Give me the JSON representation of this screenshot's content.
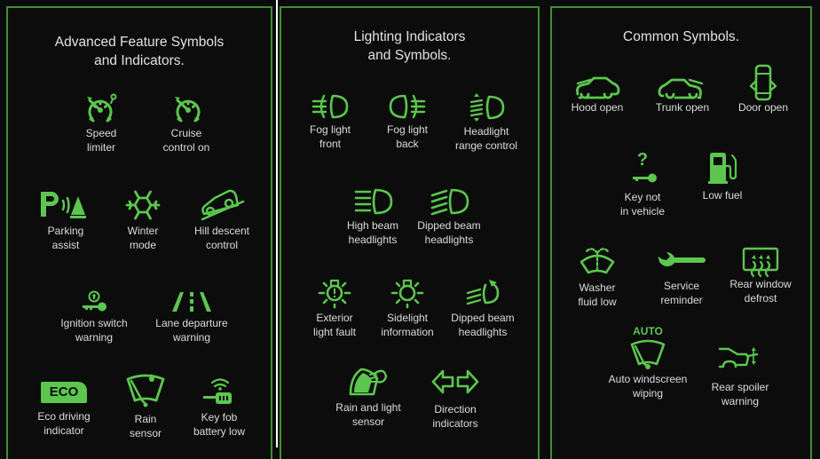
{
  "accent_color": "#5cc64f",
  "border_color": "#3f8f33",
  "panels": [
    {
      "title_line1": "Advanced Feature Symbols",
      "title_line2": "and Indicators.",
      "items": [
        {
          "icon": "speed-limiter-icon",
          "line1": "Speed",
          "line2": "limiter"
        },
        {
          "icon": "cruise-control-icon",
          "line1": "Cruise",
          "line2": "control on"
        },
        {
          "icon": "parking-assist-icon",
          "line1": "Parking",
          "line2": "assist"
        },
        {
          "icon": "winter-mode-icon",
          "line1": "Winter",
          "line2": "mode"
        },
        {
          "icon": "hill-descent-icon",
          "line1": "Hill descent",
          "line2": "control"
        },
        {
          "icon": "ignition-switch-icon",
          "line1": "Ignition switch",
          "line2": "warning"
        },
        {
          "icon": "lane-departure-icon",
          "line1": "Lane departure",
          "line2": "warning"
        },
        {
          "icon": "eco-driving-icon",
          "icon_text": "ECO",
          "line1": "Eco driving",
          "line2": "indicator"
        },
        {
          "icon": "rain-sensor-icon",
          "line1": "Rain",
          "line2": "sensor"
        },
        {
          "icon": "key-fob-battery-icon",
          "line1": "Key fob",
          "line2": "battery low"
        }
      ]
    },
    {
      "title_line1": "Lighting Indicators",
      "title_line2": "and Symbols.",
      "items": [
        {
          "icon": "fog-light-front-icon",
          "line1": "Fog light",
          "line2": "front"
        },
        {
          "icon": "fog-light-back-icon",
          "line1": "Fog light",
          "line2": "back"
        },
        {
          "icon": "headlight-range-icon",
          "line1": "Headlight",
          "line2": "range control"
        },
        {
          "icon": "high-beam-icon",
          "line1": "High beam",
          "line2": "headlights"
        },
        {
          "icon": "dipped-beam-icon",
          "line1": "Dipped beam",
          "line2": "headlights"
        },
        {
          "icon": "exterior-light-fault-icon",
          "line1": "Exterior",
          "line2": "light fault"
        },
        {
          "icon": "sidelight-icon",
          "line1": "Sidelight",
          "line2": "information"
        },
        {
          "icon": "dipped-beam-adaptive-icon",
          "line1": "Dipped beam",
          "line2": "headlights"
        },
        {
          "icon": "rain-light-sensor-icon",
          "line1": "Rain and light",
          "line2": "sensor"
        },
        {
          "icon": "direction-indicators-icon",
          "line1": "Direction",
          "line2": "indicators"
        }
      ]
    },
    {
      "title_line1": "Common Symbols.",
      "items": [
        {
          "icon": "hood-open-icon",
          "line1": "Hood open"
        },
        {
          "icon": "trunk-open-icon",
          "line1": "Trunk open"
        },
        {
          "icon": "door-open-icon",
          "line1": "Door open"
        },
        {
          "icon": "key-not-in-vehicle-icon",
          "icon_text": "?",
          "line1": "Key not",
          "line2": "in vehicle"
        },
        {
          "icon": "low-fuel-icon",
          "line1": "Low fuel"
        },
        {
          "icon": "washer-fluid-icon",
          "line1": "Washer",
          "line2": "fluid low"
        },
        {
          "icon": "service-reminder-icon",
          "line1": "Service",
          "line2": "reminder"
        },
        {
          "icon": "rear-window-defrost-icon",
          "line1": "Rear window",
          "line2": "defrost"
        },
        {
          "icon": "auto-wiping-icon",
          "icon_text": "AUTO",
          "line1": "Auto windscreen",
          "line2": "wiping"
        },
        {
          "icon": "rear-spoiler-icon",
          "line1": "Rear spoiler",
          "line2": "warning"
        }
      ]
    }
  ]
}
